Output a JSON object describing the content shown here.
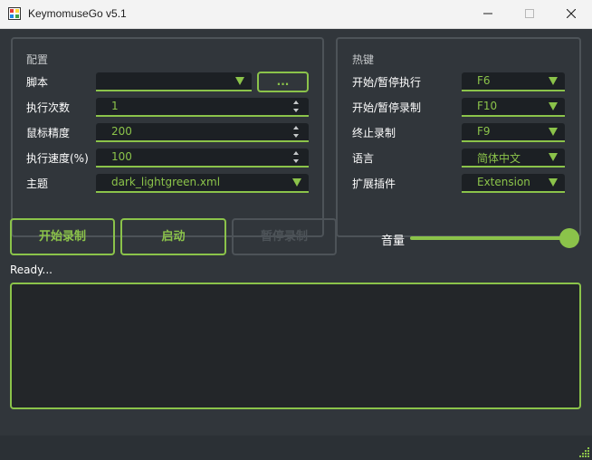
{
  "window": {
    "title": "KeymomuseGo v5.1"
  },
  "config": {
    "group_title": "配置",
    "script_label": "脚本",
    "script_value": "",
    "browse_label": "...",
    "exec_count_label": "执行次数",
    "exec_count_value": "1",
    "mouse_precision_label": "鼠标精度",
    "mouse_precision_value": "200",
    "exec_speed_label": "执行速度(%)",
    "exec_speed_value": "100",
    "theme_label": "主题",
    "theme_value": "dark_lightgreen.xml"
  },
  "hotkeys": {
    "group_title": "热键",
    "start_pause_exec_label": "开始/暂停执行",
    "start_pause_exec_value": "F6",
    "start_pause_record_label": "开始/暂停录制",
    "start_pause_record_value": "F10",
    "stop_record_label": "终止录制",
    "stop_record_value": "F9",
    "language_label": "语言",
    "language_value": "简体中文",
    "extension_label": "扩展插件",
    "extension_value": "Extension"
  },
  "actions": {
    "start_record_label": "开始录制",
    "launch_label": "启动",
    "pause_record_label": "暂停录制"
  },
  "volume": {
    "label": "音量",
    "level_fraction": 1.0
  },
  "status": {
    "text": "Ready..."
  },
  "colors": {
    "accent": "#8bc34a",
    "background": "#31363b",
    "field_background": "#1c2024",
    "border": "#4d5358"
  }
}
